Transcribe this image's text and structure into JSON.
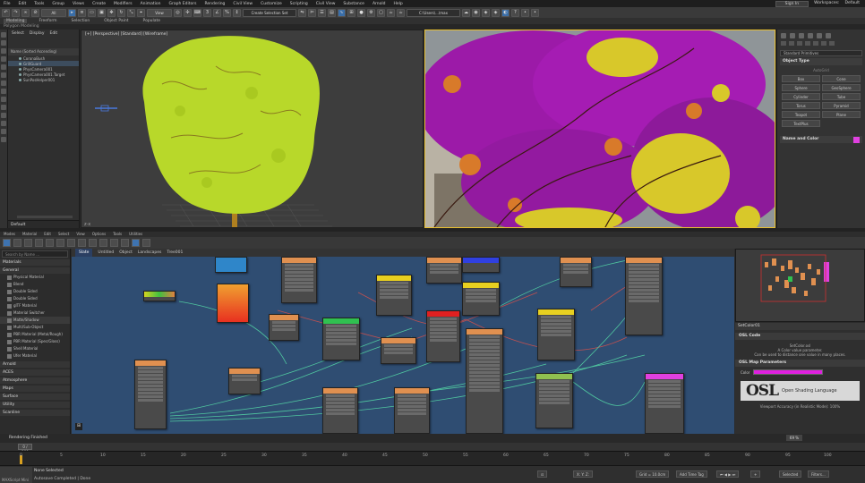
{
  "menubar": {
    "items": [
      "File",
      "Edit",
      "Tools",
      "Group",
      "Views",
      "Create",
      "Modifiers",
      "Animation",
      "Graph Editors",
      "Rendering",
      "Civil View",
      "Customize",
      "Scripting",
      "Civil View",
      "Substance",
      "Arnold",
      "Help"
    ],
    "sign_in": "Sign In",
    "workspaces": "Workspaces:",
    "workspace_value": "Default"
  },
  "toolbar": {
    "selection_filter": "All",
    "view_dropdown": "View",
    "named_selection": "Create Selection Set",
    "scene_dropdown": "C:\\Users\\...\\max"
  },
  "ribbon": {
    "tabs": [
      "Modeling",
      "Freeform",
      "Selection",
      "Object Paint",
      "Populate"
    ],
    "active": "Modeling",
    "subtitle": "Polygon Modeling"
  },
  "explorer": {
    "tabs": [
      "Select",
      "Display",
      "Edit"
    ],
    "header": "Name (Sorted Ascending)",
    "rows": [
      "CoronaBush",
      "GrillGuard",
      "PhysCamera001",
      "PhysCamera001.Target",
      "SunPosHelper001"
    ],
    "footer": "Default"
  },
  "viewport_left": {
    "label": "[+] [Perspective] [Standard] [Wireframe]"
  },
  "command_panel": {
    "dropdown": "Standard Primitives",
    "rollout_object_type": "Object Type",
    "autogrid": "AutoGrid",
    "buttons": [
      "Box",
      "Cone",
      "Sphere",
      "GeoSphere",
      "Cylinder",
      "Tube",
      "Torus",
      "Pyramid",
      "Teapot",
      "Plane",
      "TextPlus"
    ],
    "rollout_name_color": "Name and Color",
    "accent_color": "#e040e0"
  },
  "slate": {
    "menu": [
      "Modes",
      "Material",
      "Edit",
      "Select",
      "View",
      "Options",
      "Tools",
      "Utilities"
    ],
    "view_tabs": [
      "Slate",
      "Untitled",
      "Object",
      "Landscapes",
      "Tree001"
    ],
    "active_tab": "Slate",
    "browser": {
      "search": "Search by Name ...",
      "group_header": "Materials",
      "sub_header": "General",
      "items": [
        "Physical Material",
        "Blend",
        "Double Sided",
        "Double Sided",
        "glTF Material",
        "Material Switcher",
        "Matte/Shadow",
        "Multi/Sub-Object",
        "PBR Material (Metal/Rough)",
        "PBR Material (Spec/Gloss)",
        "Shell Material",
        "Ufer Material"
      ],
      "sections": [
        "Arnold",
        "ACES",
        "Atmosphere",
        "Maps",
        "Surface",
        "Utility",
        "Scanline"
      ]
    },
    "properties": {
      "title": "SetColor01",
      "rollout1": "OSL Code",
      "mode": "SetColor.osl",
      "desc1": "A Color value parameter.",
      "desc2": "Can be used to distance one value in many places.",
      "rollout2": "OSL Map Parameters",
      "color_label": "Color",
      "color_value": "#e020e0",
      "logo": "OSL",
      "logo_sub": "Open Shading Language",
      "footer": "Viewport Accuracy (in Realistic Mode): 100%"
    }
  },
  "rendering_bar": {
    "label": "Rendering Finished",
    "zoom": "69 %"
  },
  "timeline": {
    "knob": "0 / 100",
    "ticks": [
      "0",
      "5",
      "10",
      "15",
      "20",
      "25",
      "30",
      "35",
      "40",
      "45",
      "50",
      "55",
      "60",
      "65",
      "70",
      "75",
      "80",
      "85",
      "90",
      "95",
      "100"
    ]
  },
  "statusbar": {
    "line1": "None Selected",
    "line2": "Autosave Completed  |  Done",
    "maxscript": "MAXScript Mini",
    "grid": "Grid = 10.0cm",
    "add_time_tag": "Add Time Tag",
    "selected": "Selected",
    "filters": "Filters..."
  }
}
